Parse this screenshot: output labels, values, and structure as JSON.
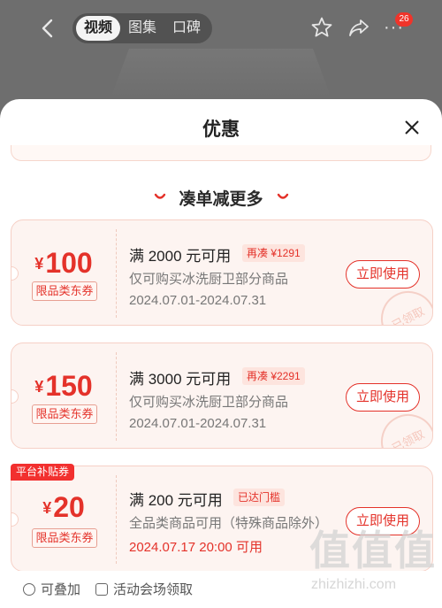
{
  "topbar": {
    "tabs": [
      "视频",
      "图集",
      "口碑"
    ],
    "active_tab": 0,
    "badge_count": "26"
  },
  "sheet": {
    "title": "优惠",
    "section_title": "凑单减更多"
  },
  "coupons": [
    {
      "currency": "¥",
      "amount": "100",
      "category": "限品类东券",
      "condition": "满 2000 元可用",
      "tag": "再凑 ¥1291",
      "description": "仅可购买冰洗厨卫部分商品",
      "date": "2024.07.01-2024.07.31",
      "button": "立即使用",
      "stamp": "已领取"
    },
    {
      "currency": "¥",
      "amount": "150",
      "category": "限品类东券",
      "condition": "满 3000 元可用",
      "tag": "再凑 ¥2291",
      "description": "仅可购买冰洗厨卫部分商品",
      "date": "2024.07.01-2024.07.31",
      "button": "立即使用",
      "stamp": "已领取"
    },
    {
      "label": "平台补贴券",
      "currency": "¥",
      "amount": "20",
      "category": "限品类东券",
      "condition": "满 200 元可用",
      "tag": "已达门槛",
      "description": "全品类商品可用（特殊商品除外）",
      "date": "2024.07.17 20:00 可用",
      "button": "立即使用"
    }
  ],
  "footer": {
    "stackable": "可叠加",
    "venue": "活动会场领取"
  },
  "watermark": {
    "big": "值值值",
    "small": "zhizhizhi.com"
  },
  "colors": {
    "accent": "#e4322a",
    "card_bg": "#fdf4f1",
    "card_border": "#f6d0c6"
  }
}
